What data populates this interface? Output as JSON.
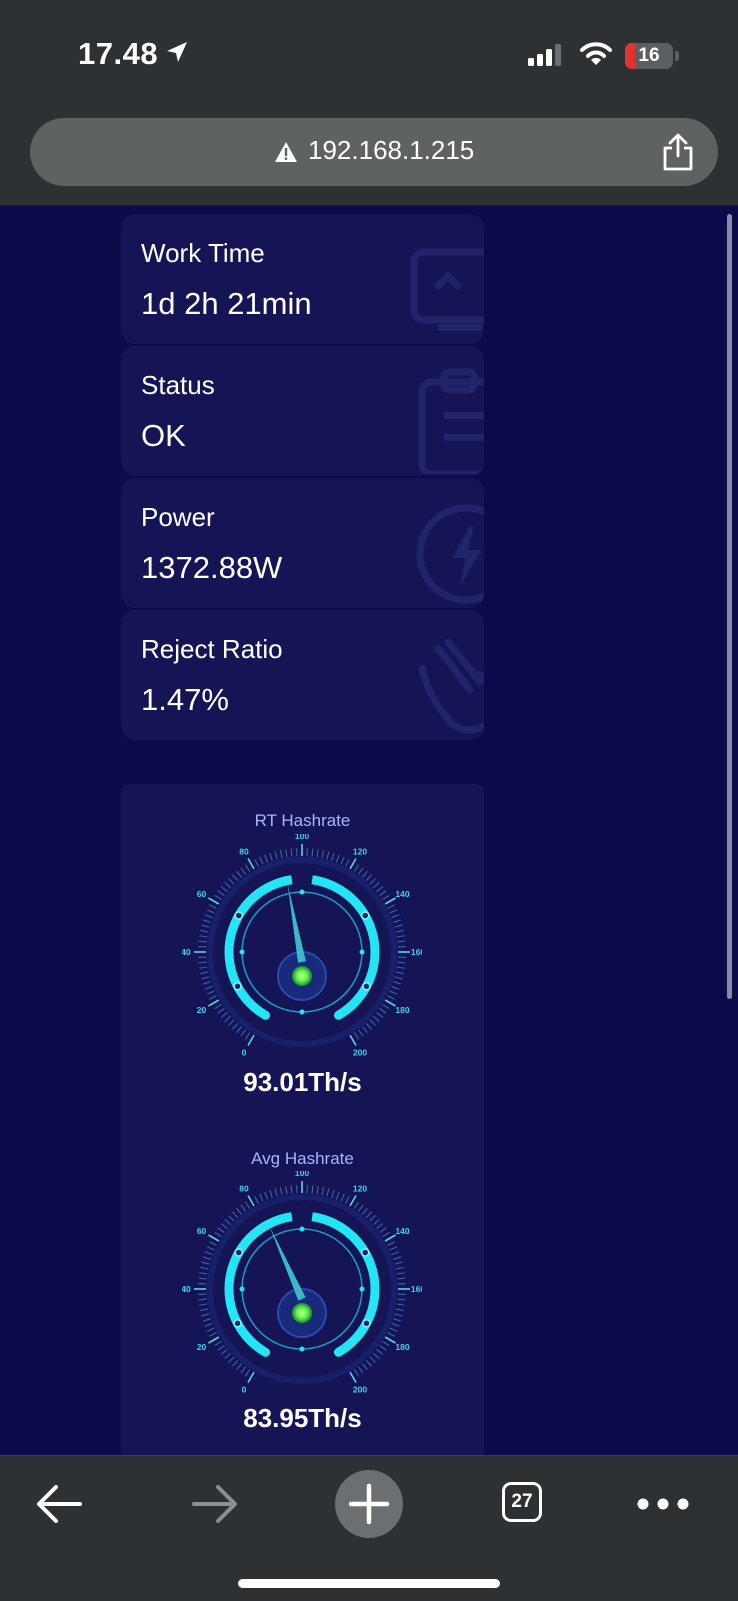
{
  "status_bar": {
    "time": "17.48",
    "battery_level": "16",
    "icons": [
      "location-arrow-icon",
      "cellular-signal-icon",
      "wifi-icon",
      "battery-icon"
    ]
  },
  "browser": {
    "url": "192.168.1.215",
    "security": "warning-triangle-icon",
    "tab_count": "27",
    "toolbar_icons": [
      "back-arrow-icon",
      "forward-arrow-icon",
      "new-tab-plus-icon",
      "tabs-icon",
      "more-icon"
    ]
  },
  "stats": [
    {
      "label": "Work Time",
      "value": "1d 2h 21min",
      "icon": "monitor-icon"
    },
    {
      "label": "Status",
      "value": "OK",
      "icon": "clipboard-icon"
    },
    {
      "label": "Power",
      "value": "1372.88W",
      "icon": "lightning-icon"
    },
    {
      "label": "Reject Ratio",
      "value": "1.47%",
      "icon": "hand-icon"
    }
  ],
  "gauges": [
    {
      "title": "RT Hashrate",
      "value_text": "93.01Th/s",
      "value": 93.01
    },
    {
      "title": "Avg Hashrate",
      "value_text": "83.95Th/s",
      "value": 83.95
    }
  ],
  "gauge_scale": {
    "min": 0,
    "max": 200,
    "ticks": [
      "0",
      "20",
      "40",
      "60",
      "80",
      "100",
      "120",
      "140",
      "160",
      "180",
      "200"
    ]
  },
  "colors": {
    "page_bg": "#0b0b4a",
    "card_bg": "#151556",
    "gauge_accent": "#22e6f5",
    "gauge_center": "#5cf04a",
    "chrome_bg": "#2e3133"
  }
}
